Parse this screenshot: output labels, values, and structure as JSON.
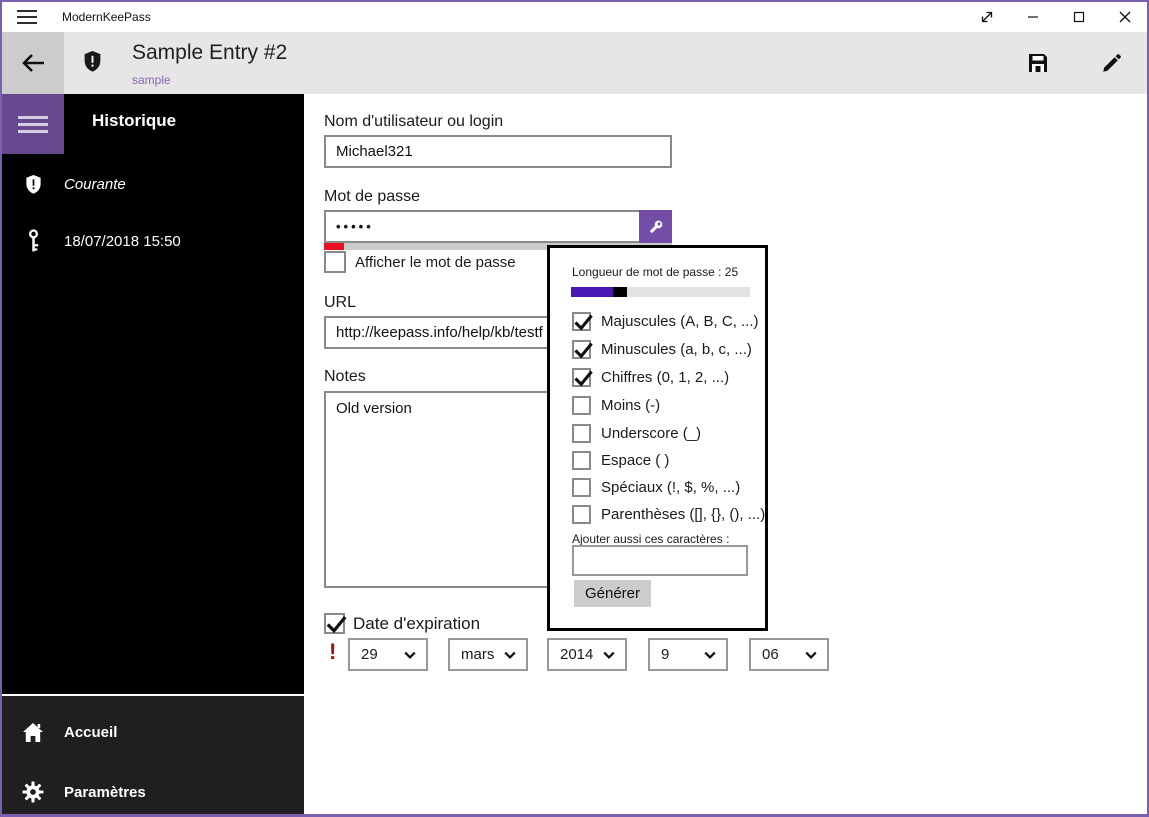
{
  "colors": {
    "accent_purple": "#744da9",
    "hamburger_purple": "#67498f",
    "window_border": "#7a5fae",
    "subtitle_purple": "#8764b8",
    "slider_purple": "#4a16b4",
    "strength_red": "#e81123",
    "warning_red": "#b00b0b",
    "sidebar_bg": "#000000",
    "sidebar_footer_bg": "#1f1f1f",
    "header_bg": "#e6e6e6"
  },
  "titlebar": {
    "app_title": "ModernKeePass",
    "icons": [
      "hamburger-icon",
      "fullscreen-icon",
      "minimize-icon",
      "maximize-icon",
      "close-icon"
    ]
  },
  "header": {
    "title": "Sample Entry #2",
    "subtitle": "sample",
    "icons": [
      "back-arrow-icon",
      "shield-alert-icon",
      "save-icon",
      "edit-pencil-icon"
    ]
  },
  "sidebar": {
    "heading": "Historique",
    "items": [
      {
        "icon": "shield-alert-icon",
        "label": "Courante",
        "italic": true
      },
      {
        "icon": "key-icon",
        "label": "18/07/2018 15:50",
        "italic": false
      }
    ],
    "footer_items": [
      {
        "icon": "home-icon",
        "label": "Accueil"
      },
      {
        "icon": "gear-icon",
        "label": "Paramètres"
      }
    ]
  },
  "form": {
    "username_label": "Nom d'utilisateur ou login",
    "username_value": "Michael321",
    "password_label": "Mot de passe",
    "password_value": "•••••",
    "password_strength_percent": 6,
    "show_password_label": "Afficher le mot de passe",
    "show_password_checked": false,
    "url_label": "URL",
    "url_value": "http://keepass.info/help/kb/testf",
    "notes_label": "Notes",
    "notes_value": "Old version",
    "expiration_label": "Date d'expiration",
    "expiration_checked": true,
    "expiration_warning": "!",
    "date_parts": [
      "29",
      "mars",
      "2014",
      "9",
      "06"
    ]
  },
  "generator_popup": {
    "length_label": "Longueur de mot de passe : 25",
    "length_value": 25,
    "options": [
      {
        "label": "Majuscules (A, B, C, ...)",
        "checked": true
      },
      {
        "label": "Minuscules (a, b, c, ...)",
        "checked": true
      },
      {
        "label": "Chiffres (0, 1, 2, ...)",
        "checked": true
      },
      {
        "label": "Moins (-)",
        "checked": false
      },
      {
        "label": "Underscore (_)",
        "checked": false
      },
      {
        "label": "Espace ( )",
        "checked": false
      },
      {
        "label": "Spéciaux (!, $, %, ...)",
        "checked": false
      },
      {
        "label": "Parenthèses ([], {}, (), ...)",
        "checked": false
      }
    ],
    "additional_chars_label": "Ajouter aussi ces caractères :",
    "additional_chars_value": "",
    "generate_button": "Générer"
  }
}
